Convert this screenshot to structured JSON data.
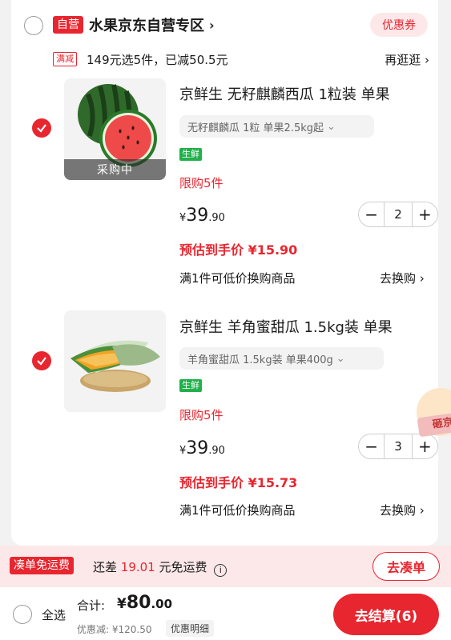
{
  "store": {
    "self_tag": "自营",
    "name": "水果京东自营专区",
    "chevron": "›",
    "coupon": "优惠券"
  },
  "promo": {
    "tag": "满减",
    "text": "149元选5件，已减50.5元",
    "more": "再逛逛 ›"
  },
  "items": [
    {
      "image_overlay": "采购中",
      "title": "京鲜生 无籽麒麟西瓜 1粒装 单果",
      "spec": "无籽麒麟瓜 1粒 单果2.5kg起",
      "fresh_tag": "生鲜",
      "limit": "限购5件",
      "price_yen": "¥",
      "price_int": "39",
      "price_dec": ".90",
      "qty": "2",
      "minus": "−",
      "plus": "+",
      "estimate": "预估到手价 ¥15.90",
      "swap_text": "满1件可低价换购商品",
      "swap_link": "去换购 ›"
    },
    {
      "title": "京鲜生 羊角蜜甜瓜 1.5kg装 单果",
      "spec": "羊角蜜甜瓜 1.5kg装 单果400g",
      "fresh_tag": "生鲜",
      "limit": "限购5件",
      "price_yen": "¥",
      "price_int": "39",
      "price_dec": ".90",
      "qty": "3",
      "minus": "−",
      "plus": "+",
      "estimate": "预估到手价 ¥15.73",
      "swap_text": "满1件可低价换购商品",
      "swap_link": "去换购 ›"
    }
  ],
  "floating": {
    "tag": "砸京"
  },
  "freeship": {
    "tag": "凑单免运费",
    "prefix": "还差",
    "amount": "19.01",
    "suffix": "元免运费",
    "info": "i",
    "button": "去凑单"
  },
  "footer": {
    "select_all": "全选",
    "total_label": "合计:",
    "total_yen": "¥",
    "total_int": "80",
    "total_dec": ".00",
    "discount": "优惠减: ¥120.50",
    "discount_detail": "优惠明细",
    "checkout": "去结算(6)"
  },
  "colors": {
    "accent": "#e8262f",
    "fresh": "#21b04b"
  }
}
